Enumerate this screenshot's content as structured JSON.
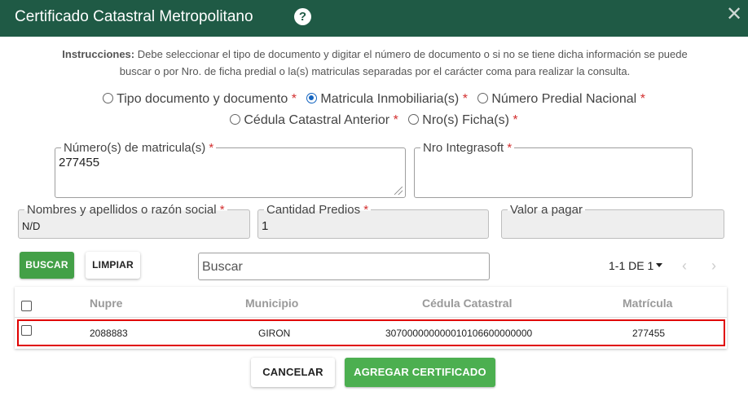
{
  "header": {
    "title": "Certificado Catastral Metropolitano",
    "help_label": "?",
    "close_label": "✕"
  },
  "instructions": {
    "label": "Instrucciones:",
    "line1": "Debe seleccionar el tipo de documento y digitar el número de documento o si no se tiene dicha información se puede",
    "line2": "buscar o por Nro. de ficha predial o la(s) matriculas separadas por el carácter coma para realizar la consulta."
  },
  "search_types": {
    "selected": "Matricula Inmobiliaria(s)",
    "options": [
      {
        "label": "Tipo documento y documento",
        "required": "*"
      },
      {
        "label": "Matricula Inmobiliaria(s)",
        "required": "*"
      },
      {
        "label": "Número Predial Nacional",
        "required": "*"
      },
      {
        "label": "Cédula Catastral Anterior",
        "required": "*"
      },
      {
        "label": "Nro(s) Ficha(s)",
        "required": "*"
      }
    ]
  },
  "form": {
    "matricula": {
      "label": "Número(s) de matricula(s)",
      "required": "*",
      "value": "277455"
    },
    "integrasoft": {
      "label": "Nro Integrasoft",
      "required": "*",
      "value": ""
    },
    "nombres": {
      "label": "Nombres y apellidos o razón social",
      "required": "*",
      "value": "N/D"
    },
    "cantidad": {
      "label": "Cantidad Predios",
      "required": "*",
      "value": "1"
    },
    "valor": {
      "label": "Valor a pagar",
      "value": ""
    }
  },
  "toolbar": {
    "buscar_label": "BUSCAR",
    "limpiar_label": "LIMPIAR",
    "search_placeholder": "Buscar",
    "pagination": "1-1 DE 1",
    "prev": "‹",
    "next": "›"
  },
  "table": {
    "columns": [
      "Nupre",
      "Municipio",
      "Cédula Catastral",
      "Matrícula"
    ],
    "rows": [
      {
        "nupre": "2088883",
        "municipio": "GIRON",
        "cedula": "307000000000010106600000000",
        "matricula": "277455",
        "selected": false
      }
    ]
  },
  "footer": {
    "cancel_label": "CANCELAR",
    "add_label": "AGREGAR CERTIFICADO"
  },
  "colors": {
    "header_bg": "#1f5a45",
    "primary_green": "#43a047",
    "radio_blue": "#1565c0",
    "required_red": "#d32f2f",
    "highlight_red": "#e00000"
  }
}
